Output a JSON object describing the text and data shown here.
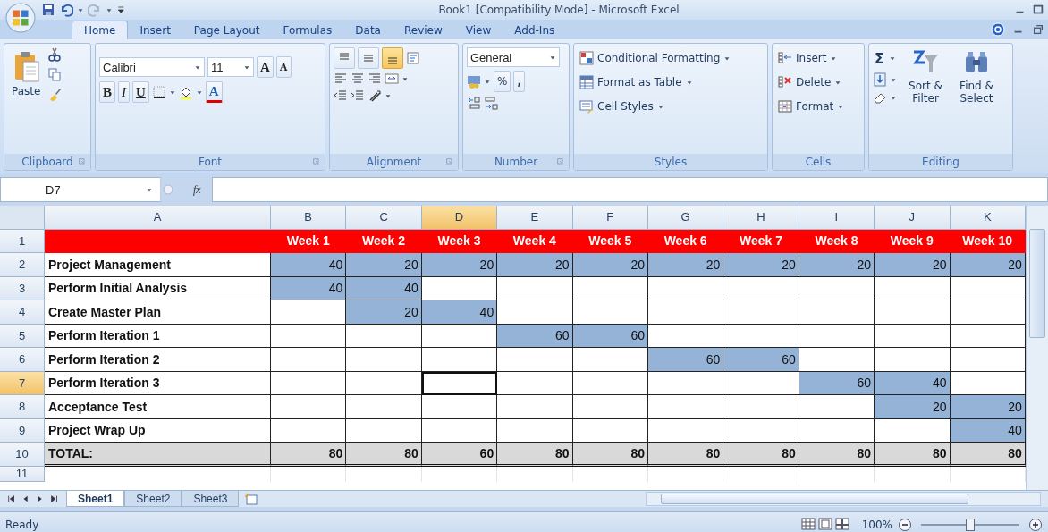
{
  "window": {
    "title": "Book1  [Compatibility Mode] - Microsoft Excel"
  },
  "tabs": [
    {
      "label": "Home",
      "selected": true
    },
    {
      "label": "Insert",
      "selected": false
    },
    {
      "label": "Page Layout",
      "selected": false
    },
    {
      "label": "Formulas",
      "selected": false
    },
    {
      "label": "Data",
      "selected": false
    },
    {
      "label": "Review",
      "selected": false
    },
    {
      "label": "View",
      "selected": false
    },
    {
      "label": "Add-Ins",
      "selected": false
    }
  ],
  "ribbon": {
    "clipboard": {
      "label": "Clipboard",
      "paste": "Paste"
    },
    "font": {
      "label": "Font",
      "name": "Calibri",
      "size": "11",
      "grow": "A",
      "shrink": "A",
      "bold": "B",
      "italic": "I",
      "underline": "U",
      "font_color_button": "A"
    },
    "alignment": {
      "label": "Alignment",
      "vertical": [
        {
          "kind": "top",
          "on": false
        },
        {
          "kind": "middle",
          "on": false
        },
        {
          "kind": "bottom",
          "on": true
        }
      ]
    },
    "number": {
      "label": "Number",
      "format": "General",
      "percent": "%",
      "comma": ","
    },
    "styles": {
      "label": "Styles",
      "items": [
        {
          "kind": "conditional",
          "label": "Conditional Formatting"
        },
        {
          "kind": "table",
          "label": "Format as Table"
        },
        {
          "kind": "styles",
          "label": "Cell Styles"
        }
      ]
    },
    "cells": {
      "label": "Cells",
      "items": [
        {
          "kind": "insert",
          "label": "Insert"
        },
        {
          "kind": "delete",
          "label": "Delete"
        },
        {
          "kind": "format",
          "label": "Format"
        }
      ]
    },
    "editing": {
      "label": "Editing",
      "sum": "Σ",
      "sort": "Sort & Filter",
      "find": "Find & Select"
    }
  },
  "formula_bar": {
    "name_box": "D7",
    "fx": "fx"
  },
  "columns": [
    {
      "label": "A",
      "selected": false
    },
    {
      "label": "B",
      "selected": false
    },
    {
      "label": "C",
      "selected": false
    },
    {
      "label": "D",
      "selected": true
    },
    {
      "label": "E",
      "selected": false
    },
    {
      "label": "F",
      "selected": false
    },
    {
      "label": "G",
      "selected": false
    },
    {
      "label": "H",
      "selected": false
    },
    {
      "label": "I",
      "selected": false
    },
    {
      "label": "J",
      "selected": false
    },
    {
      "label": "K",
      "selected": false
    }
  ],
  "rows": [
    {
      "number": "1",
      "selected": false,
      "kind": "header",
      "cells": [
        {
          "selected": false
        },
        {
          "text": "Week 1",
          "selected": false
        },
        {
          "text": "Week 2",
          "selected": false
        },
        {
          "text": "Week 3",
          "selected": false
        },
        {
          "text": "Week 4",
          "selected": false
        },
        {
          "text": "Week 5",
          "selected": false
        },
        {
          "text": "Week 6",
          "selected": false
        },
        {
          "text": "Week 7",
          "selected": false
        },
        {
          "text": "Week 8",
          "selected": false
        },
        {
          "text": "Week 9",
          "selected": false
        },
        {
          "text": "Week 10",
          "selected": false
        }
      ]
    },
    {
      "number": "2",
      "selected": false,
      "kind": "task",
      "cells": [
        {
          "text": "Project Management",
          "shaded": false,
          "selected": false
        },
        {
          "text": "40",
          "shaded": true,
          "selected": false
        },
        {
          "text": "20",
          "shaded": true,
          "selected": false
        },
        {
          "text": "20",
          "shaded": true,
          "selected": false
        },
        {
          "text": "20",
          "shaded": true,
          "selected": false
        },
        {
          "text": "20",
          "shaded": true,
          "selected": false
        },
        {
          "text": "20",
          "shaded": true,
          "selected": false
        },
        {
          "text": "20",
          "shaded": true,
          "selected": false
        },
        {
          "text": "20",
          "shaded": true,
          "selected": false
        },
        {
          "text": "20",
          "shaded": true,
          "selected": false
        },
        {
          "text": "20",
          "shaded": true,
          "selected": false
        }
      ]
    },
    {
      "number": "3",
      "selected": false,
      "kind": "task",
      "cells": [
        {
          "text": "Perform Initial Analysis",
          "shaded": false,
          "selected": false
        },
        {
          "text": "40",
          "shaded": true,
          "selected": false
        },
        {
          "text": "40",
          "shaded": true,
          "selected": false
        },
        {
          "shaded": false,
          "selected": false
        },
        {
          "shaded": false,
          "selected": false
        },
        {
          "shaded": false,
          "selected": false
        },
        {
          "shaded": false,
          "selected": false
        },
        {
          "shaded": false,
          "selected": false
        },
        {
          "shaded": false,
          "selected": false
        },
        {
          "shaded": false,
          "selected": false
        },
        {
          "shaded": false,
          "selected": false
        }
      ]
    },
    {
      "number": "4",
      "selected": false,
      "kind": "task",
      "cells": [
        {
          "text": "Create Master Plan",
          "shaded": false,
          "selected": false
        },
        {
          "shaded": false,
          "selected": false
        },
        {
          "text": "20",
          "shaded": true,
          "selected": false
        },
        {
          "text": "40",
          "shaded": true,
          "selected": false
        },
        {
          "shaded": false,
          "selected": false
        },
        {
          "shaded": false,
          "selected": false
        },
        {
          "shaded": false,
          "selected": false
        },
        {
          "shaded": false,
          "selected": false
        },
        {
          "shaded": false,
          "selected": false
        },
        {
          "shaded": false,
          "selected": false
        },
        {
          "shaded": false,
          "selected": false
        }
      ]
    },
    {
      "number": "5",
      "selected": false,
      "kind": "task",
      "cells": [
        {
          "text": "Perform Iteration 1",
          "shaded": false,
          "selected": false
        },
        {
          "shaded": false,
          "selected": false
        },
        {
          "shaded": false,
          "selected": false
        },
        {
          "shaded": false,
          "selected": false
        },
        {
          "text": "60",
          "shaded": true,
          "selected": false
        },
        {
          "text": "60",
          "shaded": true,
          "selected": false
        },
        {
          "shaded": false,
          "selected": false
        },
        {
          "shaded": false,
          "selected": false
        },
        {
          "shaded": false,
          "selected": false
        },
        {
          "shaded": false,
          "selected": false
        },
        {
          "shaded": false,
          "selected": false
        }
      ]
    },
    {
      "number": "6",
      "selected": false,
      "kind": "task",
      "cells": [
        {
          "text": "Perform Iteration 2",
          "shaded": false,
          "selected": false
        },
        {
          "shaded": false,
          "selected": false
        },
        {
          "shaded": false,
          "selected": false
        },
        {
          "shaded": false,
          "selected": false
        },
        {
          "shaded": false,
          "selected": false
        },
        {
          "shaded": false,
          "selected": false
        },
        {
          "text": "60",
          "shaded": true,
          "selected": false
        },
        {
          "text": "60",
          "shaded": true,
          "selected": false
        },
        {
          "shaded": false,
          "selected": false
        },
        {
          "shaded": false,
          "selected": false
        },
        {
          "shaded": false,
          "selected": false
        }
      ]
    },
    {
      "number": "7",
      "selected": true,
      "kind": "task",
      "cells": [
        {
          "text": "Perform Iteration 3",
          "shaded": false,
          "selected": false
        },
        {
          "shaded": false,
          "selected": false
        },
        {
          "shaded": false,
          "selected": false
        },
        {
          "shaded": false,
          "selected": true
        },
        {
          "shaded": false,
          "selected": false
        },
        {
          "shaded": false,
          "selected": false
        },
        {
          "shaded": false,
          "selected": false
        },
        {
          "shaded": false,
          "selected": false
        },
        {
          "text": "60",
          "shaded": true,
          "selected": false
        },
        {
          "text": "40",
          "shaded": true,
          "selected": false
        },
        {
          "shaded": false,
          "selected": false
        }
      ]
    },
    {
      "number": "8",
      "selected": false,
      "kind": "task",
      "cells": [
        {
          "text": "Acceptance Test",
          "shaded": false,
          "selected": false
        },
        {
          "shaded": false,
          "selected": false
        },
        {
          "shaded": false,
          "selected": false
        },
        {
          "shaded": false,
          "selected": false
        },
        {
          "shaded": false,
          "selected": false
        },
        {
          "shaded": false,
          "selected": false
        },
        {
          "shaded": false,
          "selected": false
        },
        {
          "shaded": false,
          "selected": false
        },
        {
          "shaded": false,
          "selected": false
        },
        {
          "text": "20",
          "shaded": true,
          "selected": false
        },
        {
          "text": "20",
          "shaded": true,
          "selected": false
        }
      ]
    },
    {
      "number": "9",
      "selected": false,
      "kind": "task",
      "cells": [
        {
          "text": "Project Wrap Up",
          "shaded": false,
          "selected": false
        },
        {
          "shaded": false,
          "selected": false
        },
        {
          "shaded": false,
          "selected": false
        },
        {
          "shaded": false,
          "selected": false
        },
        {
          "shaded": false,
          "selected": false
        },
        {
          "shaded": false,
          "selected": false
        },
        {
          "shaded": false,
          "selected": false
        },
        {
          "shaded": false,
          "selected": false
        },
        {
          "shaded": false,
          "selected": false
        },
        {
          "shaded": false,
          "selected": false
        },
        {
          "text": "40",
          "shaded": true,
          "selected": false
        }
      ]
    },
    {
      "number": "10",
      "selected": false,
      "kind": "total",
      "cells": [
        {
          "text": "TOTAL:",
          "selected": false
        },
        {
          "text": "80",
          "selected": false
        },
        {
          "text": "80",
          "selected": false
        },
        {
          "text": "60",
          "selected": false
        },
        {
          "text": "80",
          "selected": false
        },
        {
          "text": "80",
          "selected": false
        },
        {
          "text": "80",
          "selected": false
        },
        {
          "text": "80",
          "selected": false
        },
        {
          "text": "80",
          "selected": false
        },
        {
          "text": "80",
          "selected": false
        },
        {
          "text": "80",
          "selected": false
        }
      ]
    },
    {
      "number": "11",
      "selected": false,
      "kind": "empty",
      "cells": []
    }
  ],
  "sheets": [
    {
      "label": "Sheet1",
      "selected": true
    },
    {
      "label": "Sheet2",
      "selected": false
    },
    {
      "label": "Sheet3",
      "selected": false
    }
  ],
  "status_bar": {
    "status": "Ready",
    "zoom": "100%",
    "zoom_level": {
      "level": 0.5
    }
  }
}
